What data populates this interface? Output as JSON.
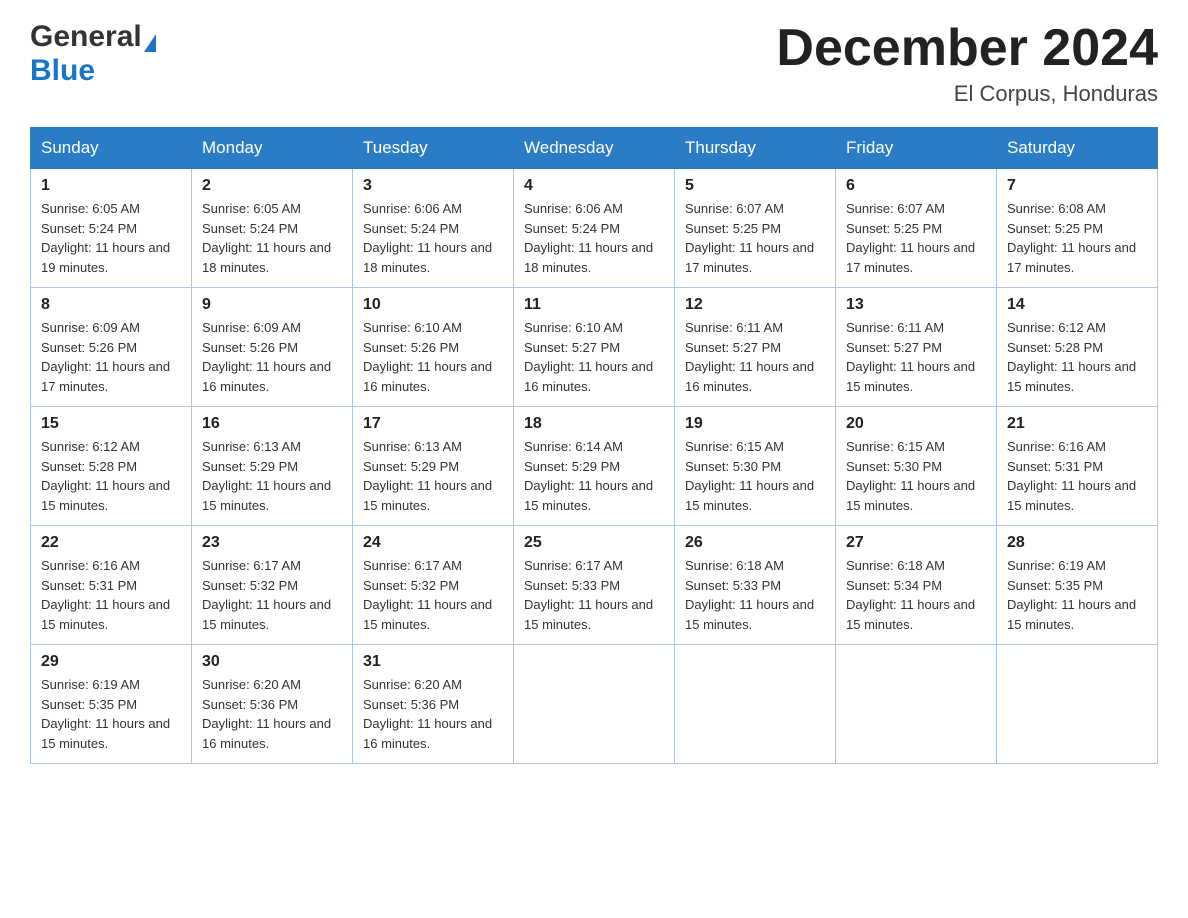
{
  "header": {
    "logo_general": "General",
    "logo_blue": "Blue",
    "month_title": "December 2024",
    "location": "El Corpus, Honduras"
  },
  "weekdays": [
    "Sunday",
    "Monday",
    "Tuesday",
    "Wednesday",
    "Thursday",
    "Friday",
    "Saturday"
  ],
  "weeks": [
    [
      {
        "day": "1",
        "sunrise": "6:05 AM",
        "sunset": "5:24 PM",
        "daylight": "11 hours and 19 minutes."
      },
      {
        "day": "2",
        "sunrise": "6:05 AM",
        "sunset": "5:24 PM",
        "daylight": "11 hours and 18 minutes."
      },
      {
        "day": "3",
        "sunrise": "6:06 AM",
        "sunset": "5:24 PM",
        "daylight": "11 hours and 18 minutes."
      },
      {
        "day": "4",
        "sunrise": "6:06 AM",
        "sunset": "5:24 PM",
        "daylight": "11 hours and 18 minutes."
      },
      {
        "day": "5",
        "sunrise": "6:07 AM",
        "sunset": "5:25 PM",
        "daylight": "11 hours and 17 minutes."
      },
      {
        "day": "6",
        "sunrise": "6:07 AM",
        "sunset": "5:25 PM",
        "daylight": "11 hours and 17 minutes."
      },
      {
        "day": "7",
        "sunrise": "6:08 AM",
        "sunset": "5:25 PM",
        "daylight": "11 hours and 17 minutes."
      }
    ],
    [
      {
        "day": "8",
        "sunrise": "6:09 AM",
        "sunset": "5:26 PM",
        "daylight": "11 hours and 17 minutes."
      },
      {
        "day": "9",
        "sunrise": "6:09 AM",
        "sunset": "5:26 PM",
        "daylight": "11 hours and 16 minutes."
      },
      {
        "day": "10",
        "sunrise": "6:10 AM",
        "sunset": "5:26 PM",
        "daylight": "11 hours and 16 minutes."
      },
      {
        "day": "11",
        "sunrise": "6:10 AM",
        "sunset": "5:27 PM",
        "daylight": "11 hours and 16 minutes."
      },
      {
        "day": "12",
        "sunrise": "6:11 AM",
        "sunset": "5:27 PM",
        "daylight": "11 hours and 16 minutes."
      },
      {
        "day": "13",
        "sunrise": "6:11 AM",
        "sunset": "5:27 PM",
        "daylight": "11 hours and 15 minutes."
      },
      {
        "day": "14",
        "sunrise": "6:12 AM",
        "sunset": "5:28 PM",
        "daylight": "11 hours and 15 minutes."
      }
    ],
    [
      {
        "day": "15",
        "sunrise": "6:12 AM",
        "sunset": "5:28 PM",
        "daylight": "11 hours and 15 minutes."
      },
      {
        "day": "16",
        "sunrise": "6:13 AM",
        "sunset": "5:29 PM",
        "daylight": "11 hours and 15 minutes."
      },
      {
        "day": "17",
        "sunrise": "6:13 AM",
        "sunset": "5:29 PM",
        "daylight": "11 hours and 15 minutes."
      },
      {
        "day": "18",
        "sunrise": "6:14 AM",
        "sunset": "5:29 PM",
        "daylight": "11 hours and 15 minutes."
      },
      {
        "day": "19",
        "sunrise": "6:15 AM",
        "sunset": "5:30 PM",
        "daylight": "11 hours and 15 minutes."
      },
      {
        "day": "20",
        "sunrise": "6:15 AM",
        "sunset": "5:30 PM",
        "daylight": "11 hours and 15 minutes."
      },
      {
        "day": "21",
        "sunrise": "6:16 AM",
        "sunset": "5:31 PM",
        "daylight": "11 hours and 15 minutes."
      }
    ],
    [
      {
        "day": "22",
        "sunrise": "6:16 AM",
        "sunset": "5:31 PM",
        "daylight": "11 hours and 15 minutes."
      },
      {
        "day": "23",
        "sunrise": "6:17 AM",
        "sunset": "5:32 PM",
        "daylight": "11 hours and 15 minutes."
      },
      {
        "day": "24",
        "sunrise": "6:17 AM",
        "sunset": "5:32 PM",
        "daylight": "11 hours and 15 minutes."
      },
      {
        "day": "25",
        "sunrise": "6:17 AM",
        "sunset": "5:33 PM",
        "daylight": "11 hours and 15 minutes."
      },
      {
        "day": "26",
        "sunrise": "6:18 AM",
        "sunset": "5:33 PM",
        "daylight": "11 hours and 15 minutes."
      },
      {
        "day": "27",
        "sunrise": "6:18 AM",
        "sunset": "5:34 PM",
        "daylight": "11 hours and 15 minutes."
      },
      {
        "day": "28",
        "sunrise": "6:19 AM",
        "sunset": "5:35 PM",
        "daylight": "11 hours and 15 minutes."
      }
    ],
    [
      {
        "day": "29",
        "sunrise": "6:19 AM",
        "sunset": "5:35 PM",
        "daylight": "11 hours and 15 minutes."
      },
      {
        "day": "30",
        "sunrise": "6:20 AM",
        "sunset": "5:36 PM",
        "daylight": "11 hours and 16 minutes."
      },
      {
        "day": "31",
        "sunrise": "6:20 AM",
        "sunset": "5:36 PM",
        "daylight": "11 hours and 16 minutes."
      },
      null,
      null,
      null,
      null
    ]
  ]
}
